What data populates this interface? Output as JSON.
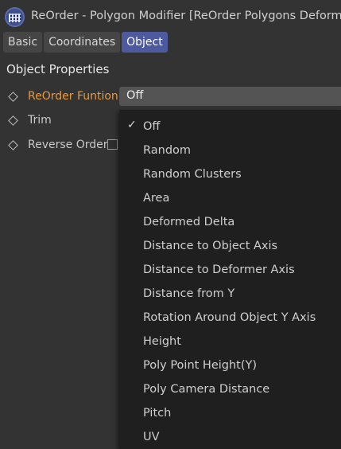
{
  "window": {
    "title": "ReOrder - Polygon Modifier [ReOrder Polygons Deformer]"
  },
  "tabs": [
    {
      "label": "Basic",
      "active": false
    },
    {
      "label": "Coordinates",
      "active": false
    },
    {
      "label": "Object",
      "active": true
    }
  ],
  "section": {
    "title": "Object Properties"
  },
  "properties": {
    "reorder_function": {
      "label": "ReOrder Funtion",
      "value": "Off"
    },
    "trim": {
      "label": "Trim"
    },
    "reverse_order": {
      "label": "Reverse Order",
      "checked": false
    }
  },
  "dropdown": {
    "selected": "Off",
    "options": [
      "Off",
      "Random",
      "Random Clusters",
      "Area",
      "Deformed Delta",
      "Distance to Object Axis",
      "Distance to Deformer Axis",
      "Distance from Y",
      "Rotation Around Object Y Axis",
      "Height",
      "Poly Point Height(Y)",
      "Poly Camera Distance",
      "Pitch",
      "UV"
    ]
  },
  "colors": {
    "background": "#333333",
    "active_tab": "#4d5aa0",
    "accent_label": "#e99a3a",
    "dropdown_bg": "#1f1f1f"
  }
}
